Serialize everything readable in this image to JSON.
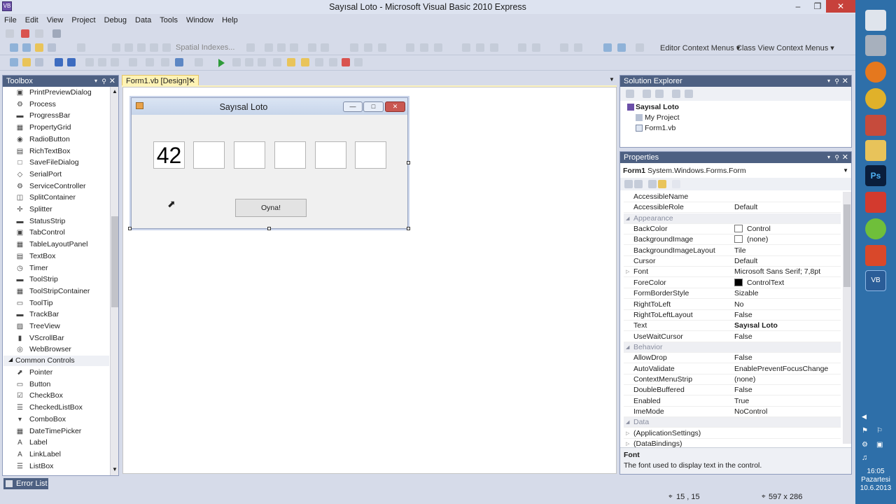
{
  "window": {
    "title": "Sayısal Loto - Microsoft Visual Basic 2010 Express",
    "icon_text": "VB"
  },
  "menu": [
    "File",
    "Edit",
    "View",
    "Project",
    "Debug",
    "Data",
    "Tools",
    "Window",
    "Help"
  ],
  "toolbar": {
    "spatial_indexes": "Spatial Indexes...",
    "editor_context_menus": "Editor Context Menus",
    "class_view_context_menus": "Class View Context Menus"
  },
  "toolbox": {
    "title": "Toolbox",
    "items": [
      "PrintPreviewDialog",
      "Process",
      "ProgressBar",
      "PropertyGrid",
      "RadioButton",
      "RichTextBox",
      "SaveFileDialog",
      "SerialPort",
      "ServiceController",
      "SplitContainer",
      "Splitter",
      "StatusStrip",
      "TabControl",
      "TableLayoutPanel",
      "TextBox",
      "Timer",
      "ToolStrip",
      "ToolStripContainer",
      "ToolTip",
      "TrackBar",
      "TreeView",
      "VScrollBar",
      "WebBrowser"
    ],
    "common_controls_header": "Common Controls",
    "common_items": [
      "Pointer",
      "Button",
      "CheckBox",
      "CheckedListBox",
      "ComboBox",
      "DateTimePicker",
      "Label",
      "LinkLabel",
      "ListBox"
    ]
  },
  "document_tab": {
    "label": "Form1.vb [Design]*"
  },
  "form": {
    "title": "Sayısal Loto",
    "boxes": [
      "42",
      "",
      "",
      "",
      "",
      ""
    ],
    "button_label": "Oyna!"
  },
  "solution_explorer": {
    "title": "Solution Explorer",
    "root": "Sayısal Loto",
    "children": [
      "My Project",
      "Form1.vb"
    ]
  },
  "properties": {
    "title": "Properties",
    "object_name": "Form1",
    "object_type": "System.Windows.Forms.Form",
    "rows": [
      {
        "name": "AccessibleName",
        "value": ""
      },
      {
        "name": "AccessibleRole",
        "value": "Default"
      },
      {
        "name": "Appearance",
        "value": "",
        "category": true
      },
      {
        "name": "BackColor",
        "value": "Control",
        "swatch": "#ffffff"
      },
      {
        "name": "BackgroundImage",
        "value": "(none)",
        "swatch": "#ffffff"
      },
      {
        "name": "BackgroundImageLayout",
        "value": "Tile"
      },
      {
        "name": "Cursor",
        "value": "Default"
      },
      {
        "name": "Font",
        "value": "Microsoft Sans Serif; 7,8pt"
      },
      {
        "name": "ForeColor",
        "value": "ControlText",
        "swatch": "#000000"
      },
      {
        "name": "FormBorderStyle",
        "value": "Sizable"
      },
      {
        "name": "RightToLeft",
        "value": "No"
      },
      {
        "name": "RightToLeftLayout",
        "value": "False"
      },
      {
        "name": "Text",
        "value": "Sayısal Loto",
        "bold": true
      },
      {
        "name": "UseWaitCursor",
        "value": "False"
      },
      {
        "name": "Behavior",
        "value": "",
        "category": true
      },
      {
        "name": "AllowDrop",
        "value": "False"
      },
      {
        "name": "AutoValidate",
        "value": "EnablePreventFocusChange"
      },
      {
        "name": "ContextMenuStrip",
        "value": "(none)"
      },
      {
        "name": "DoubleBuffered",
        "value": "False"
      },
      {
        "name": "Enabled",
        "value": "True"
      },
      {
        "name": "ImeMode",
        "value": "NoControl"
      },
      {
        "name": "Data",
        "value": "",
        "category": true
      },
      {
        "name": "(ApplicationSettings)",
        "value": ""
      },
      {
        "name": "(DataBindings)",
        "value": ""
      }
    ],
    "desc_title": "Font",
    "desc_text": "The font used to display text in the control."
  },
  "status": {
    "error_list": "Error List",
    "position": "15 , 15",
    "size": "597 x 286"
  },
  "clock": {
    "time": "16:05",
    "day": "Pazartesi",
    "date": "10.6.2013"
  }
}
